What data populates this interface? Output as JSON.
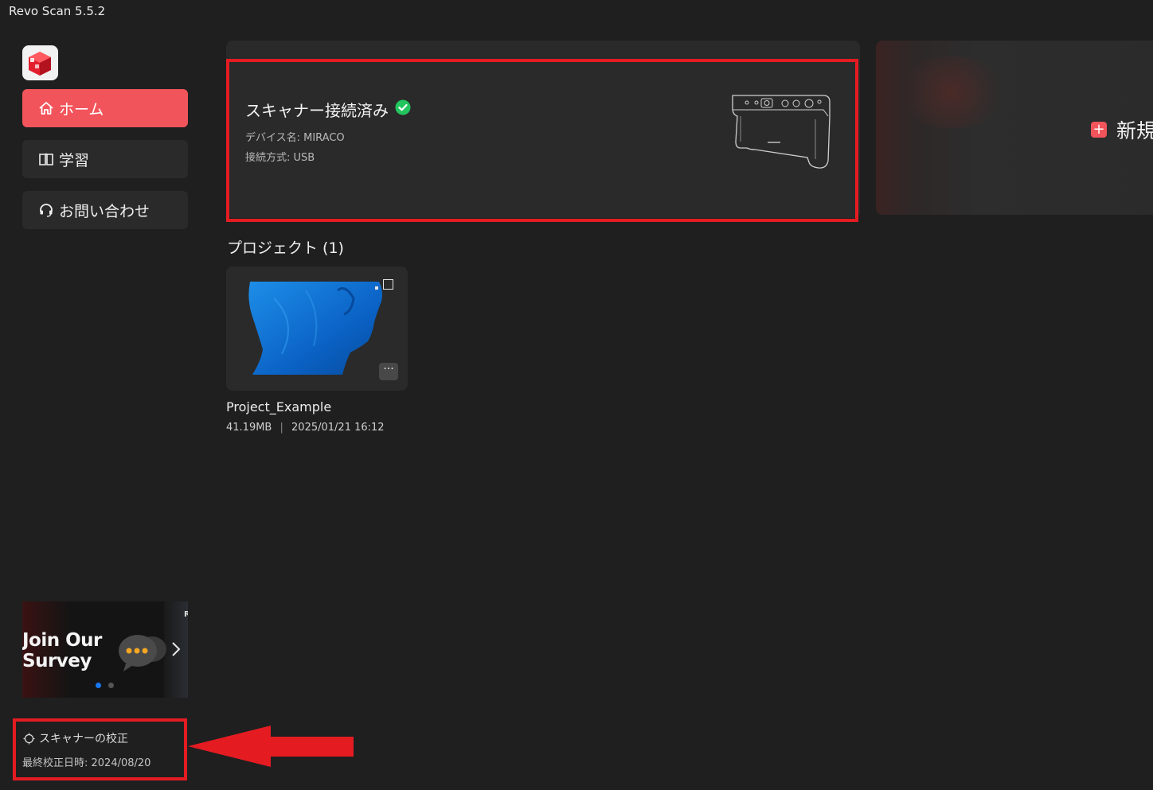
{
  "window": {
    "title": "Revo Scan 5.5.2"
  },
  "sidebar": {
    "items": [
      {
        "label": "ホーム",
        "icon": "home-icon",
        "active": true
      },
      {
        "label": "学習",
        "icon": "book-icon",
        "active": false
      },
      {
        "label": "お問い合わせ",
        "icon": "headset-icon",
        "active": false
      }
    ],
    "banner": {
      "line1": "Join Our",
      "line2": "Survey",
      "edge_text": "R",
      "active_dot_color": "#1877f2"
    },
    "calibration": {
      "label": "スキャナーの校正",
      "last_date": "最終校正日時: 2024/08/20"
    }
  },
  "scanner": {
    "status": "スキャナー接続済み",
    "device": "デバイス名: MIRACO",
    "connection": "接続方式: USB",
    "status_icon": "check-circle-icon",
    "status_color": "#22c55e"
  },
  "new_project": {
    "label": "新規"
  },
  "projects": {
    "title": "プロジェクト (1)",
    "items": [
      {
        "name": "Project_Example",
        "size": "41.19MB",
        "date": "2025/01/21 16:12"
      }
    ]
  },
  "colors": {
    "accent": "#f2545b",
    "annotation": "#e41c22",
    "background": "#1f1f1f"
  }
}
